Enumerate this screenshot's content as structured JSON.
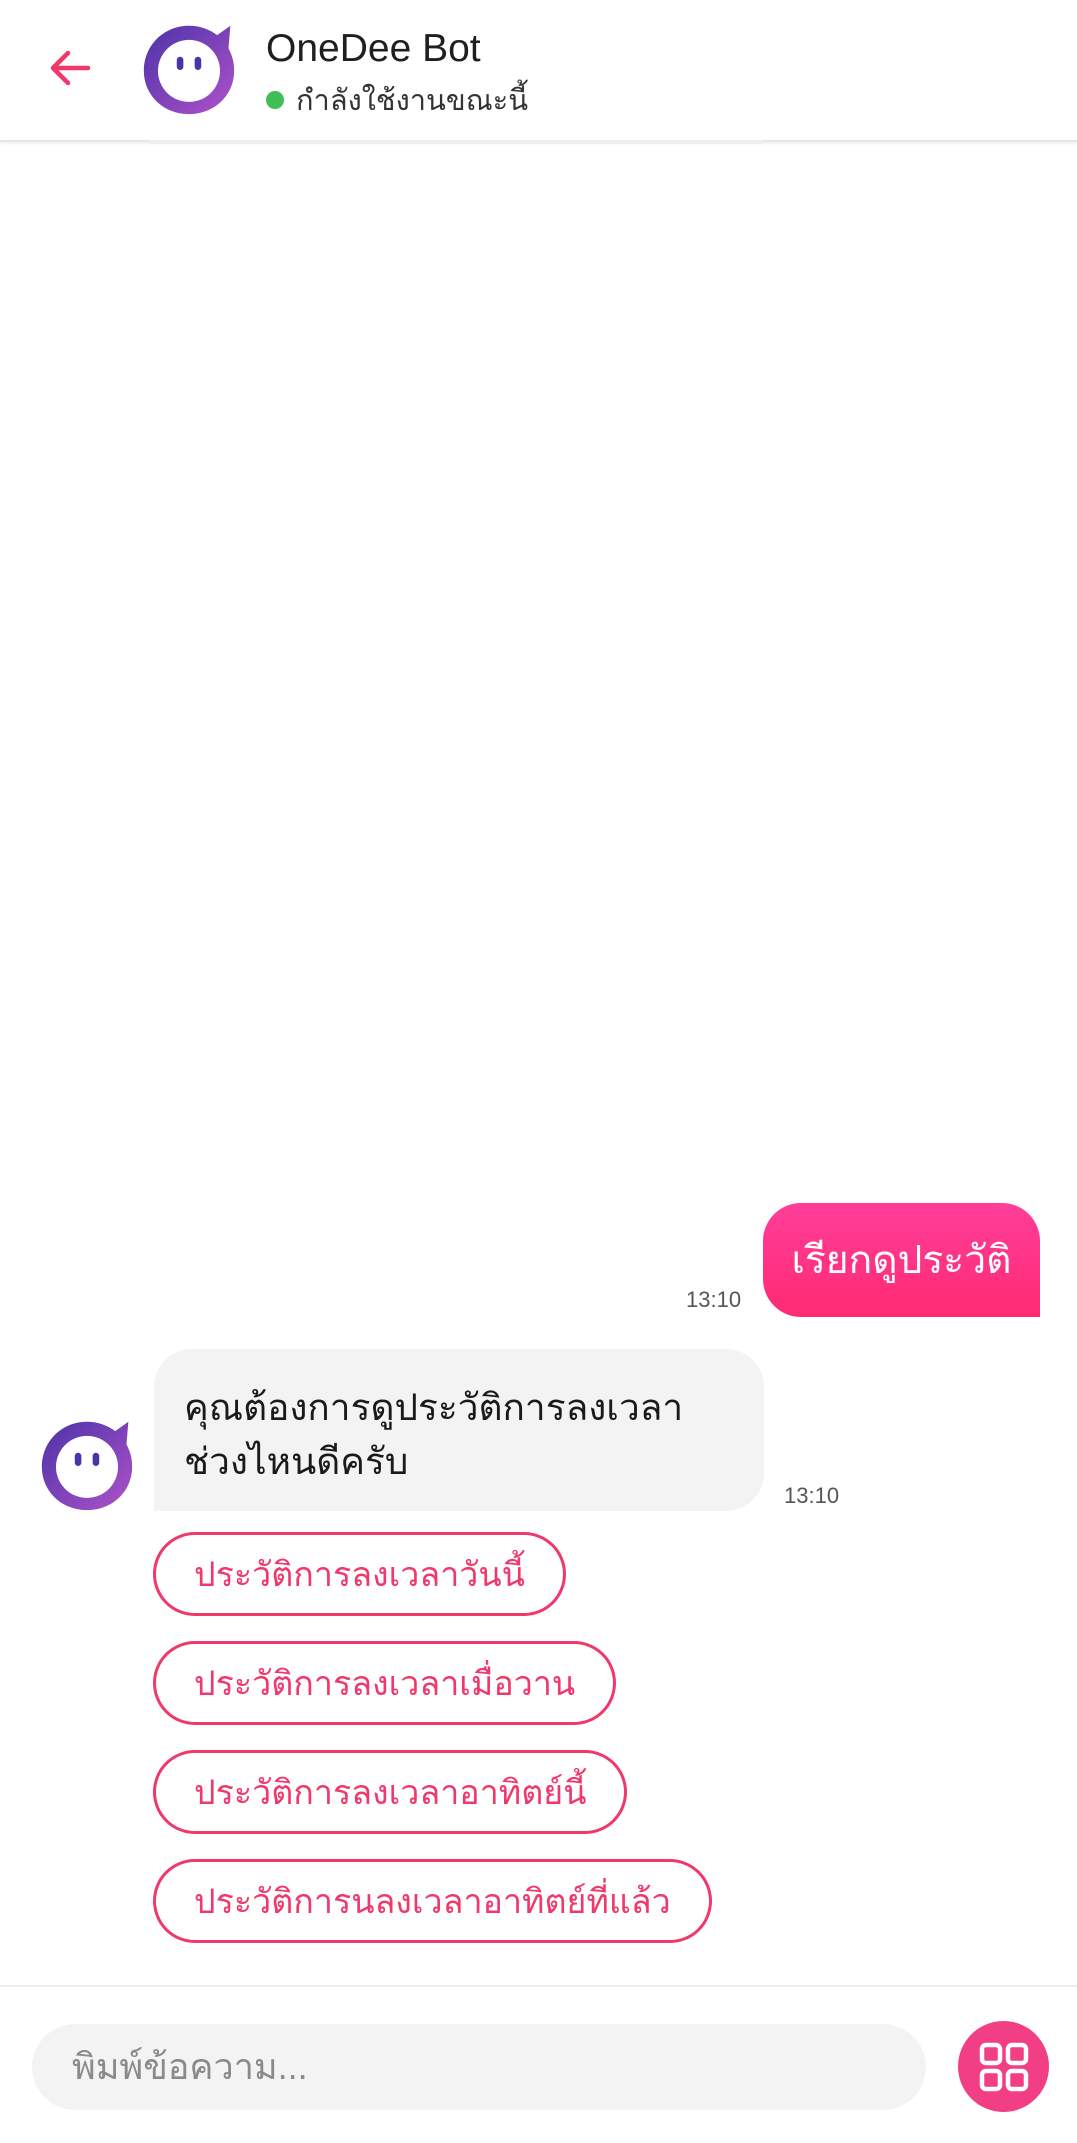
{
  "header": {
    "title": "OneDee Bot",
    "status": "กำลังใช้งานขณะนี้",
    "status_color": "#3fbf55"
  },
  "icons": {
    "back": "arrow-left-icon",
    "avatar": "bot-avatar-icon",
    "menu": "grid-menu-icon"
  },
  "messages": {
    "user": {
      "text": "เรียกดูประวัติ",
      "time": "13:10"
    },
    "bot": {
      "line1": "คุณต้องการดูประวัติการลงเวลา",
      "line2": "ช่วงไหนดีครับ",
      "time": "13:10"
    }
  },
  "quick_replies": [
    "ประวัติการลงเวลาวันนี้",
    "ประวัติการลงเวลาเมื่อวาน",
    "ประวัติการลงเวลาอาทิตย์นี้",
    "ประวัติการนลงเวลาอาทิตย์ที่แล้ว"
  ],
  "input": {
    "placeholder": "พิมพ์ข้อความ..."
  },
  "colors": {
    "accent": "#f0386a",
    "user_bubble": "#ff3e9a",
    "bot_bubble": "#f3f3f3",
    "avatar_purple": "#6a3fb5"
  }
}
